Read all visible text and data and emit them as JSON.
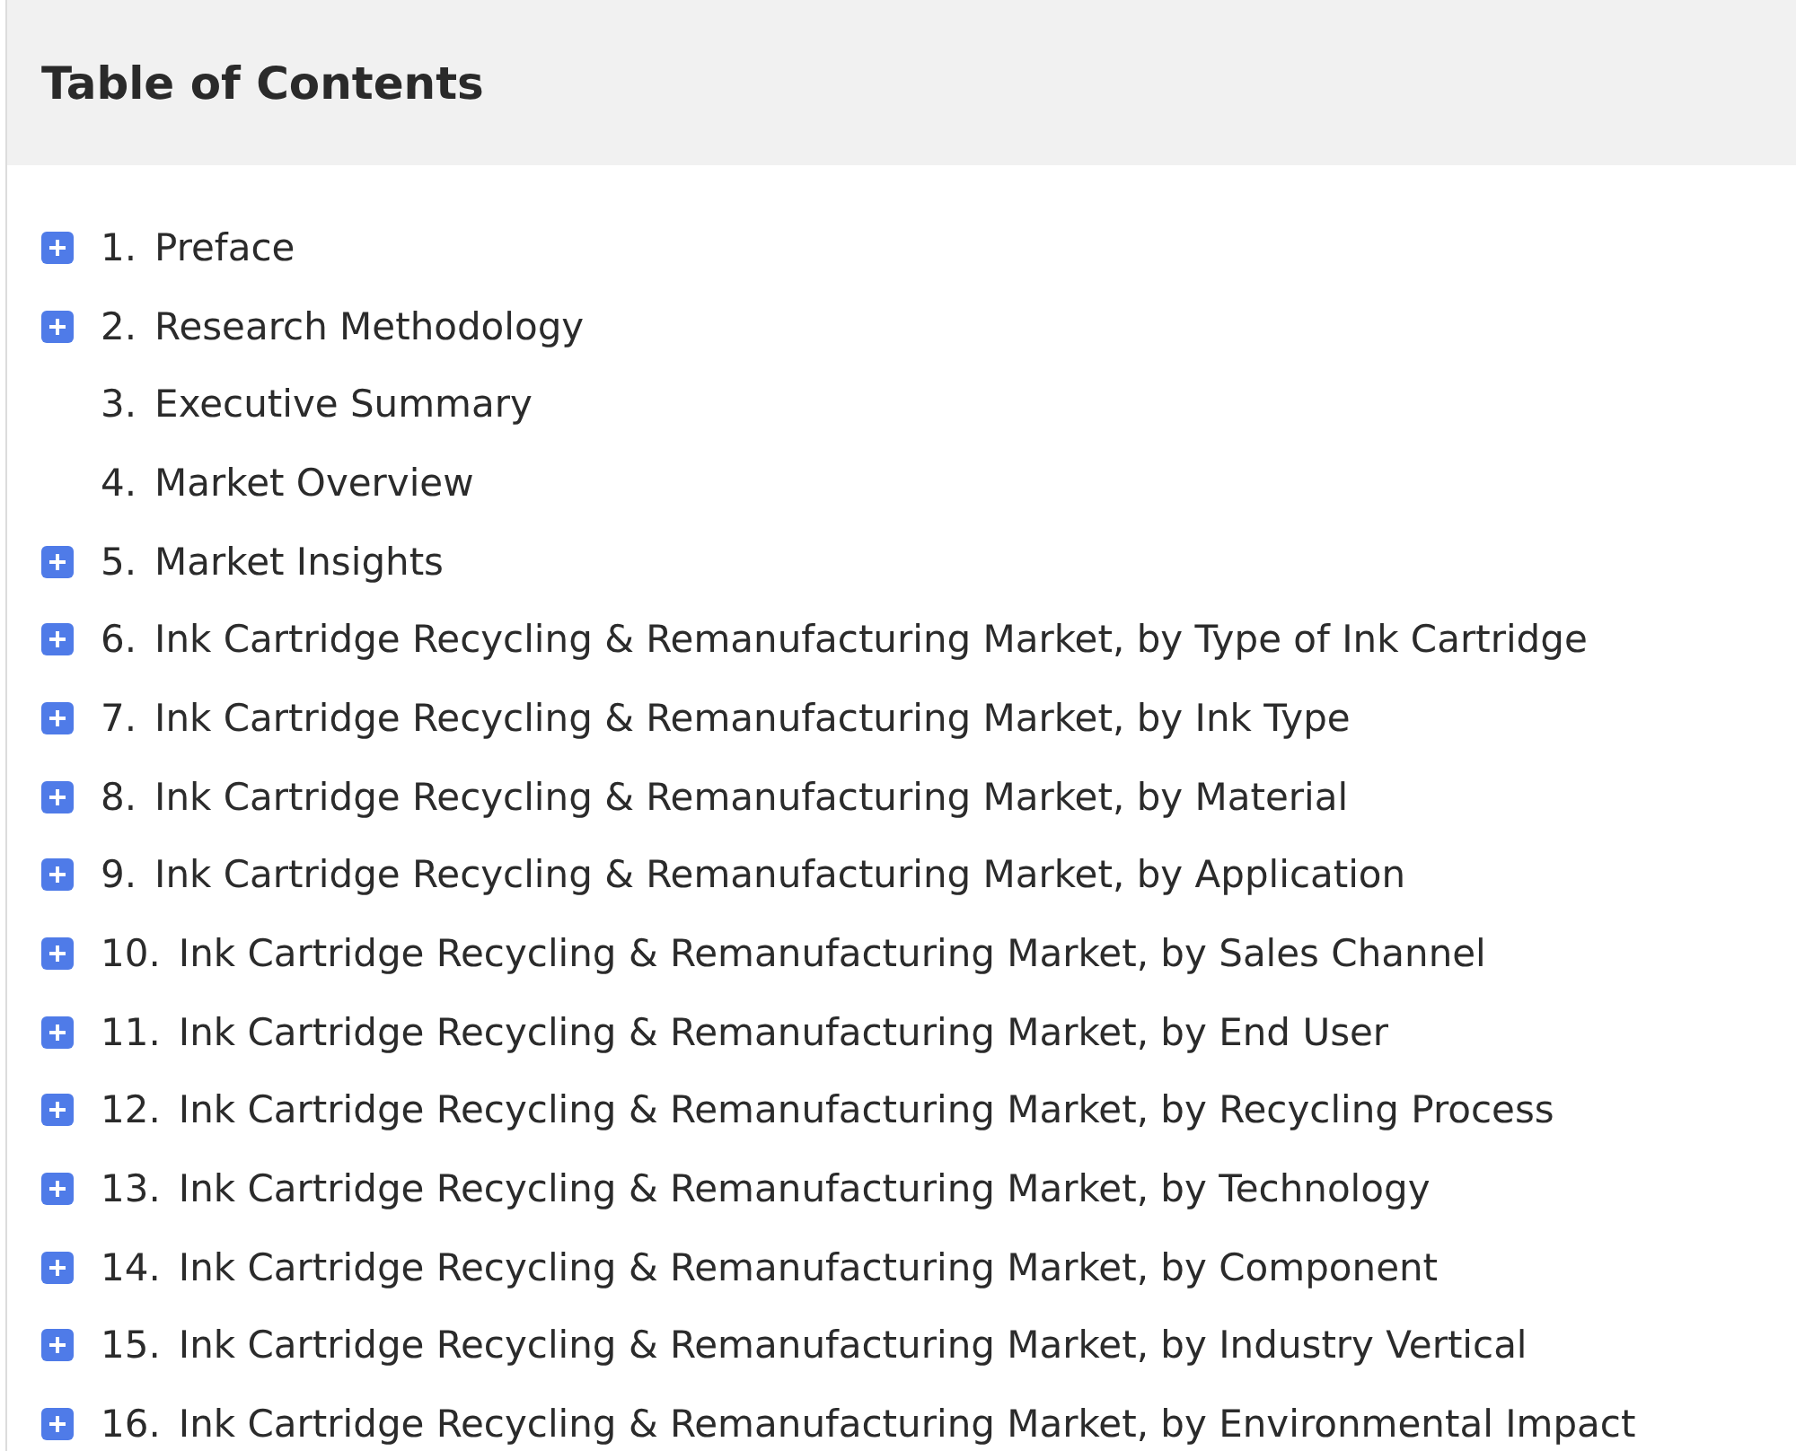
{
  "title": "Table of Contents",
  "items": [
    {
      "number": "1.",
      "label": "Preface",
      "expandable": true
    },
    {
      "number": "2.",
      "label": "Research Methodology",
      "expandable": true
    },
    {
      "number": "3.",
      "label": "Executive Summary",
      "expandable": false
    },
    {
      "number": "4.",
      "label": "Market Overview",
      "expandable": false
    },
    {
      "number": "5.",
      "label": "Market Insights",
      "expandable": true
    },
    {
      "number": "6.",
      "label": "Ink Cartridge Recycling & Remanufacturing Market, by Type of Ink Cartridge",
      "expandable": true
    },
    {
      "number": "7.",
      "label": "Ink Cartridge Recycling & Remanufacturing Market, by Ink Type",
      "expandable": true
    },
    {
      "number": "8.",
      "label": "Ink Cartridge Recycling & Remanufacturing Market, by Material",
      "expandable": true
    },
    {
      "number": "9.",
      "label": "Ink Cartridge Recycling & Remanufacturing Market, by Application",
      "expandable": true
    },
    {
      "number": "10.",
      "label": "Ink Cartridge Recycling & Remanufacturing Market, by Sales Channel",
      "expandable": true
    },
    {
      "number": "11.",
      "label": "Ink Cartridge Recycling & Remanufacturing Market, by End User",
      "expandable": true
    },
    {
      "number": "12.",
      "label": "Ink Cartridge Recycling & Remanufacturing Market, by Recycling Process",
      "expandable": true
    },
    {
      "number": "13.",
      "label": "Ink Cartridge Recycling & Remanufacturing Market, by Technology",
      "expandable": true
    },
    {
      "number": "14.",
      "label": "Ink Cartridge Recycling & Remanufacturing Market, by Component",
      "expandable": true
    },
    {
      "number": "15.",
      "label": "Ink Cartridge Recycling & Remanufacturing Market, by Industry Vertical",
      "expandable": true
    },
    {
      "number": "16.",
      "label": "Ink Cartridge Recycling & Remanufacturing Market, by Environmental Impact",
      "expandable": true
    }
  ]
}
